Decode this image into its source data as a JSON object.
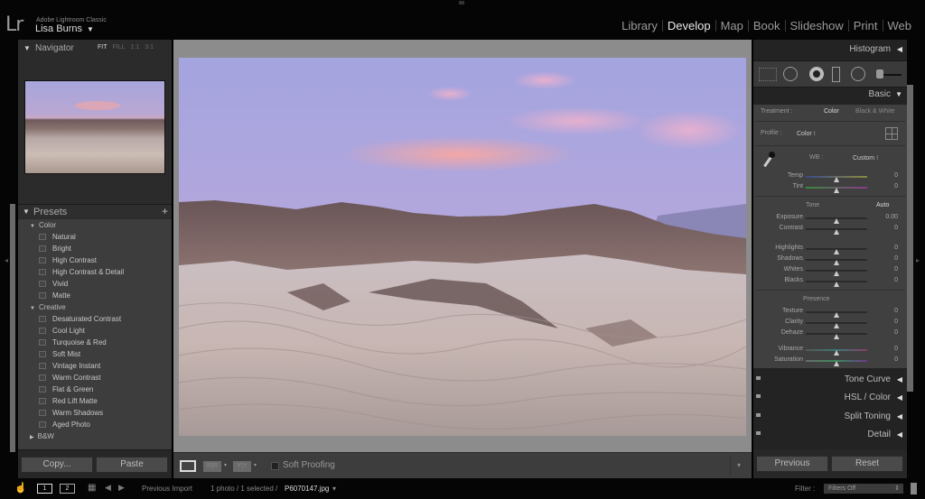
{
  "app": {
    "logo": "Lr",
    "app_name": "Adobe Lightroom Classic",
    "user_name": "Lisa Burns",
    "user_menu_icon": "triangle-down"
  },
  "modules": [
    {
      "label": "Library",
      "active": false
    },
    {
      "label": "Develop",
      "active": true
    },
    {
      "label": "Map",
      "active": false
    },
    {
      "label": "Book",
      "active": false
    },
    {
      "label": "Slideshow",
      "active": false
    },
    {
      "label": "Print",
      "active": false
    },
    {
      "label": "Web",
      "active": false
    }
  ],
  "navigator": {
    "title": "Navigator",
    "zoom_options": [
      "FIT",
      "FILL",
      "1:1",
      "3:1"
    ],
    "active_zoom": "FIT"
  },
  "presets": {
    "title": "Presets",
    "add_icon": "+",
    "groups": [
      {
        "name": "Color",
        "expanded": true,
        "items": [
          "Natural",
          "Bright",
          "High Contrast",
          "High Contrast & Detail",
          "Vivid",
          "Matte"
        ]
      },
      {
        "name": "Creative",
        "expanded": true,
        "items": [
          "Desaturated Contrast",
          "Cool Light",
          "Turquoise & Red",
          "Soft Mist",
          "Vintage Instant",
          "Warm Contrast",
          "Flat & Green",
          "Red Lift Matte",
          "Warm Shadows",
          "Aged Photo"
        ]
      },
      {
        "name": "B&W",
        "expanded": false,
        "items": []
      }
    ]
  },
  "left_footer": {
    "copy_label": "Copy...",
    "paste_label": "Paste"
  },
  "toolbar": {
    "before_after_1": "R|R",
    "before_after_2": "Y|Y",
    "soft_proofing_label": "Soft Proofing",
    "soft_proofing_checked": false
  },
  "right_panel": {
    "histogram_title": "Histogram",
    "basic": {
      "title": "Basic",
      "treatment_label": "Treatment :",
      "treatment_options": [
        "Color",
        "Black & White"
      ],
      "treatment_active": "Color",
      "profile_label": "Profile :",
      "profile_value": "Color",
      "wb_label": "WB :",
      "wb_value": "Custom",
      "tone_label": "Tone",
      "auto_label": "Auto",
      "presence_label": "Presence",
      "sliders": [
        {
          "label": "Temp",
          "value": "0",
          "position": 0.5
        },
        {
          "label": "Tint",
          "value": "0",
          "position": 0.5
        },
        {
          "label": "Exposure",
          "value": "0.00",
          "position": 0.5
        },
        {
          "label": "Contrast",
          "value": "0",
          "position": 0.5
        },
        {
          "label": "Highlights",
          "value": "0",
          "position": 0.5
        },
        {
          "label": "Shadows",
          "value": "0",
          "position": 0.5
        },
        {
          "label": "Whites",
          "value": "0",
          "position": 0.5
        },
        {
          "label": "Blacks",
          "value": "0",
          "position": 0.5
        },
        {
          "label": "Texture",
          "value": "0",
          "position": 0.5
        },
        {
          "label": "Clarity",
          "value": "0",
          "position": 0.5
        },
        {
          "label": "Dehaze",
          "value": "0",
          "position": 0.5
        },
        {
          "label": "Vibrance",
          "value": "0",
          "position": 0.5
        },
        {
          "label": "Saturation",
          "value": "0",
          "position": 0.5
        }
      ]
    },
    "collapsed_panels": [
      {
        "title": "Tone Curve"
      },
      {
        "title": "HSL / Color"
      },
      {
        "title": "Split Toning"
      },
      {
        "title": "Detail"
      }
    ]
  },
  "right_footer": {
    "previous_label": "Previous",
    "reset_label": "Reset"
  },
  "filmstrip_bar": {
    "screen_1": "1",
    "screen_2": "2",
    "source": "Previous Import",
    "selection_info": "1 photo / 1 selected /",
    "file_name": "P6070147.jpg",
    "filter_label": "Filter :",
    "filter_value": "Filters Off"
  },
  "colors": {
    "panel_bg": "#2b2b2b",
    "panel_body": "#404040",
    "canvas_bg": "#8c8c8c",
    "text_active": "#e8e8e8",
    "text_inactive": "#9a9a9a"
  }
}
